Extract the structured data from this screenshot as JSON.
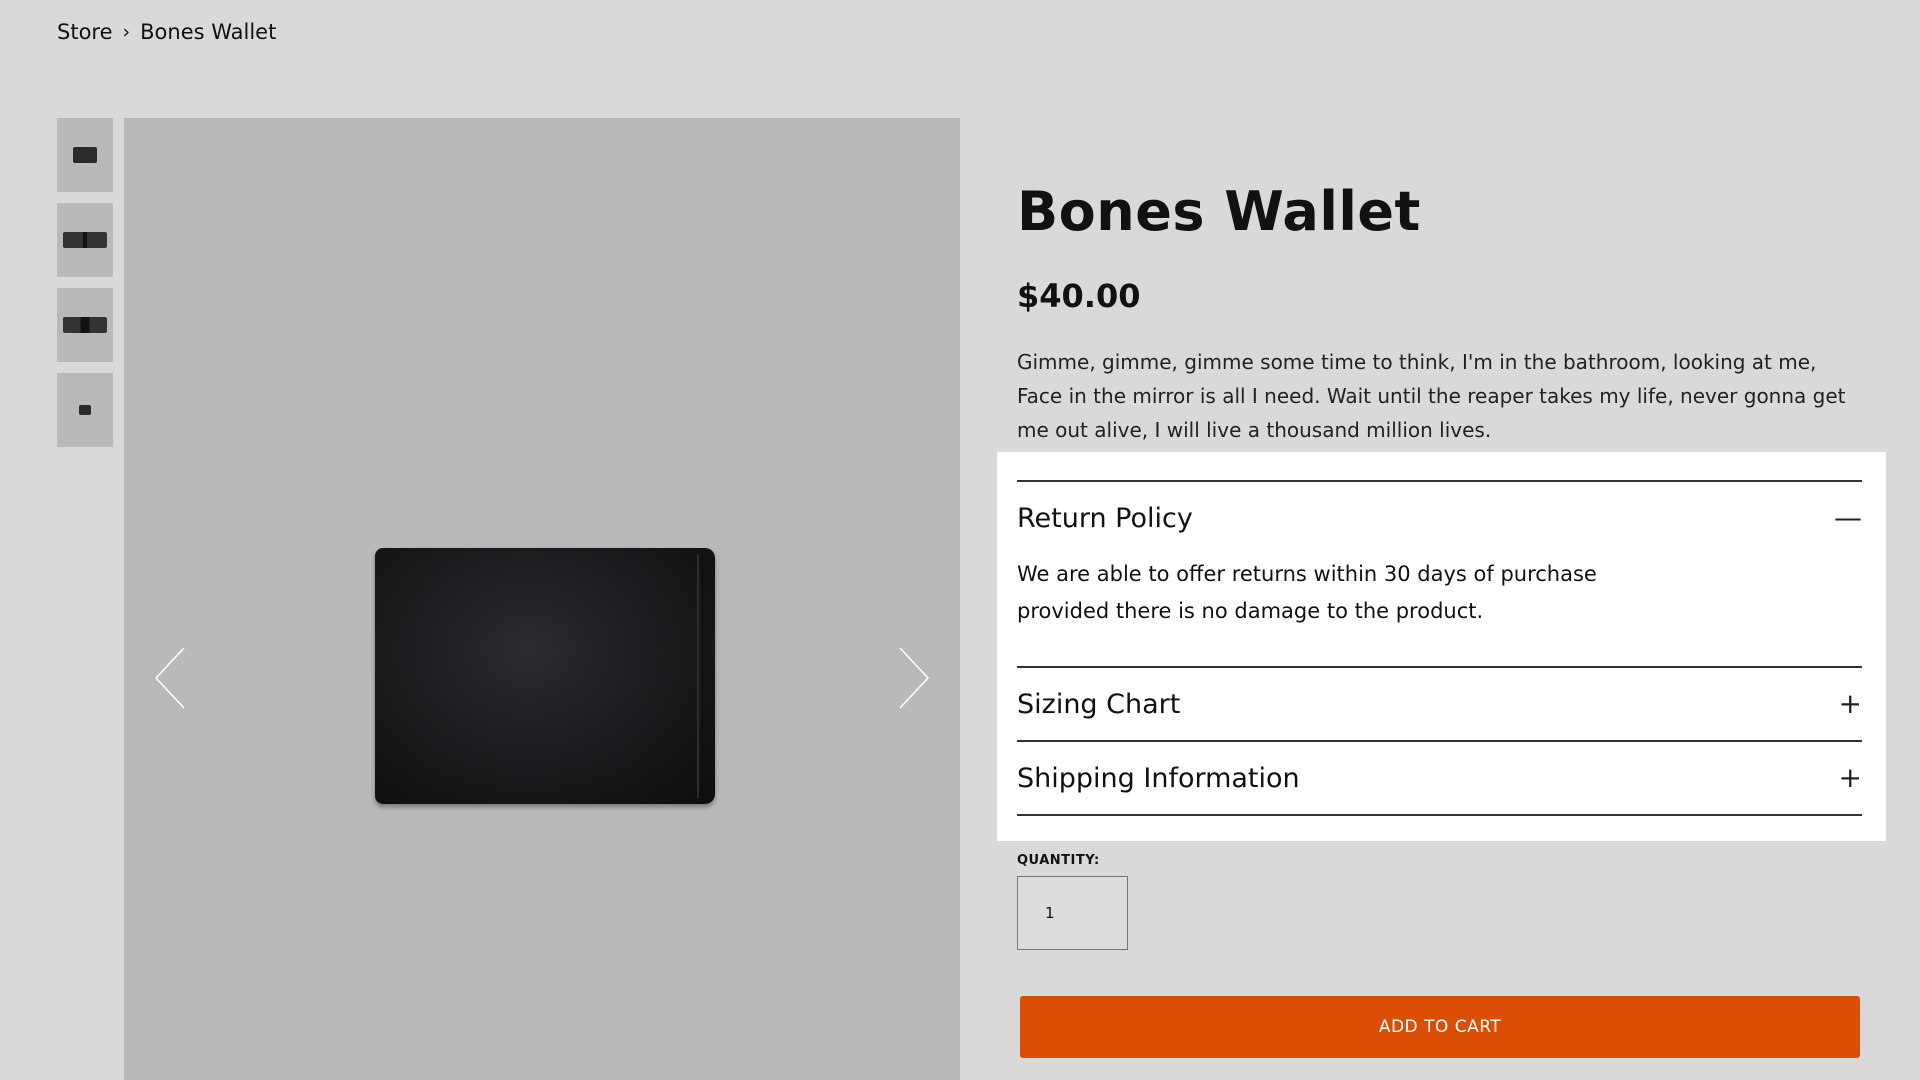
{
  "breadcrumb": {
    "store": "Store",
    "separator": "›",
    "current": "Bones Wallet"
  },
  "gallery": {
    "thumbnail_count": 4,
    "prev_icon": "chevron-left-icon",
    "next_icon": "chevron-right-icon"
  },
  "product": {
    "title": "Bones Wallet",
    "price": "$40.00",
    "description": "Gimme, gimme, gimme some time to think, I'm in the bathroom, looking at me, Face in the mirror is all I need. Wait until the reaper takes my life, never gonna get me out alive, I will live a thousand million lives."
  },
  "accordion": [
    {
      "title": "Return Policy",
      "icon": "—",
      "expanded": true,
      "body": "We are able to offer returns within 30 days of purchase provided there is no damage to the product."
    },
    {
      "title": "Sizing Chart",
      "icon": "+",
      "expanded": false
    },
    {
      "title": "Shipping Information",
      "icon": "+",
      "expanded": false
    }
  ],
  "quantity": {
    "label": "QUANTITY:",
    "value": "1"
  },
  "cart": {
    "button_label": "ADD TO CART"
  },
  "colors": {
    "background": "#d9d9d9",
    "image_background": "#b9b9b9",
    "accent": "#dc4e06",
    "panel": "#ffffff"
  }
}
